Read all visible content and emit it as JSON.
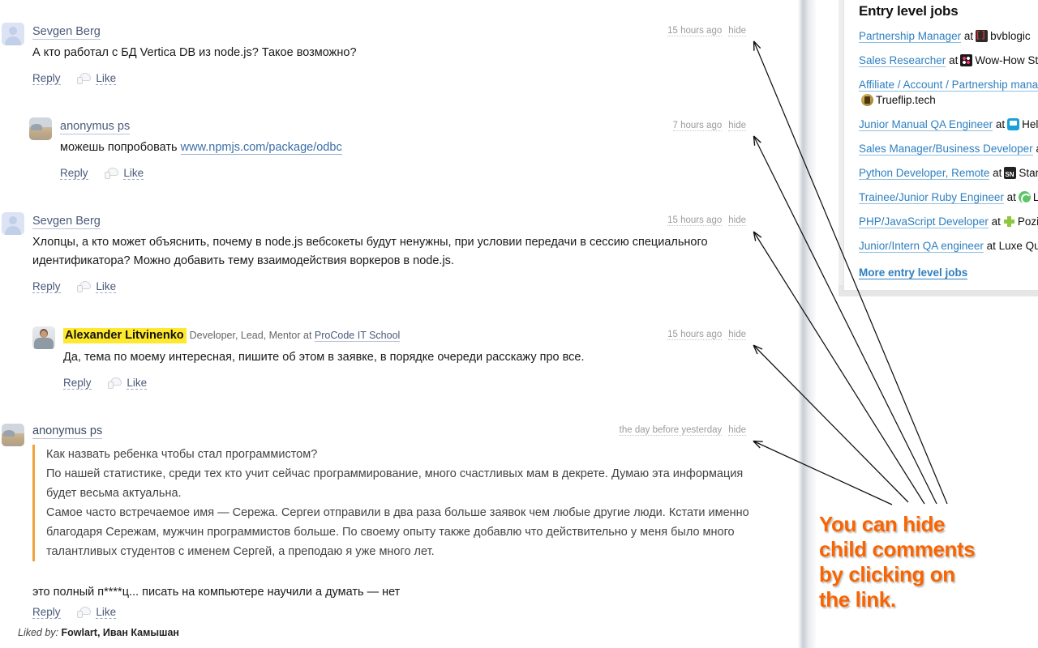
{
  "comments": [
    {
      "id": "c1",
      "author": "Sevgen Berg",
      "author_role": "",
      "time": "15 hours ago",
      "hide": "hide",
      "text": "А кто работал с БД Vertica DB из node.js? Такое возможно?",
      "reply": "Reply",
      "like": "Like"
    },
    {
      "id": "c2",
      "author": "anonymus ps",
      "time": "7 hours ago",
      "hide": "hide",
      "text_before": "можешь попробовать ",
      "link": "www.npmjs.com/package/odbc",
      "reply": "Reply",
      "like": "Like"
    },
    {
      "id": "c3",
      "author": "Sevgen Berg",
      "time": "15 hours ago",
      "hide": "hide",
      "text": "Хлопцы, а кто может объяснить, почему в node.js вебсокеты будут ненужны, при условии передачи в сессию специального идентификатора? Можно добавить тему взаимодействия воркеров в node.js.",
      "reply": "Reply",
      "like": "Like"
    },
    {
      "id": "c4",
      "author": "Alexander Litvinenko",
      "role_prefix": "Developer, Lead, Mentor at ",
      "role_link": "ProCode IT School",
      "time": "15 hours ago",
      "hide": "hide",
      "text": "Да, тема по моему интересная, пишите об этом в заявке, в порядке очереди расскажу про все.",
      "reply": "Reply",
      "like": "Like"
    },
    {
      "id": "c5",
      "author": "anonymus ps",
      "time": "the day before yesterday",
      "hide": "hide",
      "quote_line1": "Как назвать ребенка чтобы стал программистом?",
      "quote_line2": "По нашей статистике, среди тех кто учит сейчас программирование, много счастливых мам в декрете. Думаю эта информация будет весьма актуальна.",
      "quote_line3": "Самое часто встречаемое имя — Сережа. Сергеи отправили в два раза больше заявок чем любые другие люди. Кстати именно благодаря Сережам, мужчин программистов больше. По своему опыту также добавлю что действительно у меня было много талантливых студентов с именем Сергей, а преподаю я уже много лет.",
      "reply_text": "это полный п****ц... писать на компьютере научили а думать — нет",
      "reply": "Reply",
      "like": "Like",
      "liked_by_label": "Liked by:",
      "liked_by_names": "Fowlart, Иван Камышан"
    }
  ],
  "sidebar": {
    "title": "Entry level jobs",
    "jobs": [
      {
        "title": "Partnership Manager",
        "at": "at",
        "company": "bvblogic",
        "icon": "bvblogic-icon"
      },
      {
        "title": "Sales Researcher",
        "at": "at",
        "company": "Wow-How Stu",
        "icon": "wowhow-icon"
      },
      {
        "title": "Affiliate / Account / Partnership manag",
        "at": "",
        "company": "Trueflip.tech",
        "icon": "trueflip-icon",
        "wrap": true
      },
      {
        "title": "Junior Manual QA Engineer",
        "at": "at",
        "company": "Help",
        "icon": "helpcrunch-icon"
      },
      {
        "title": "Sales Manager/Business Developer",
        "at": "at",
        "company": "",
        "icon": ""
      },
      {
        "title": "Python Developer, Remote",
        "at": "at",
        "company": "StarN",
        "icon": "starnavi-icon"
      },
      {
        "title": "Trainee/Junior Ruby Engineer",
        "at": "at",
        "company": "Le",
        "icon": "ruby-icon"
      },
      {
        "title": "PHP/JavaScript Developer",
        "at": "at",
        "company": "Poziti",
        "icon": "positive-icon"
      },
      {
        "title": "Junior/Intern QA engineer",
        "at": "at",
        "company": "Luxe Qua",
        "icon": ""
      }
    ],
    "more_link": "More entry level jobs"
  },
  "annotation": {
    "line1": "You can hide",
    "line2": "child comments",
    "line3": "by clicking on",
    "line4": "the link.",
    "color": "#fa6400"
  }
}
